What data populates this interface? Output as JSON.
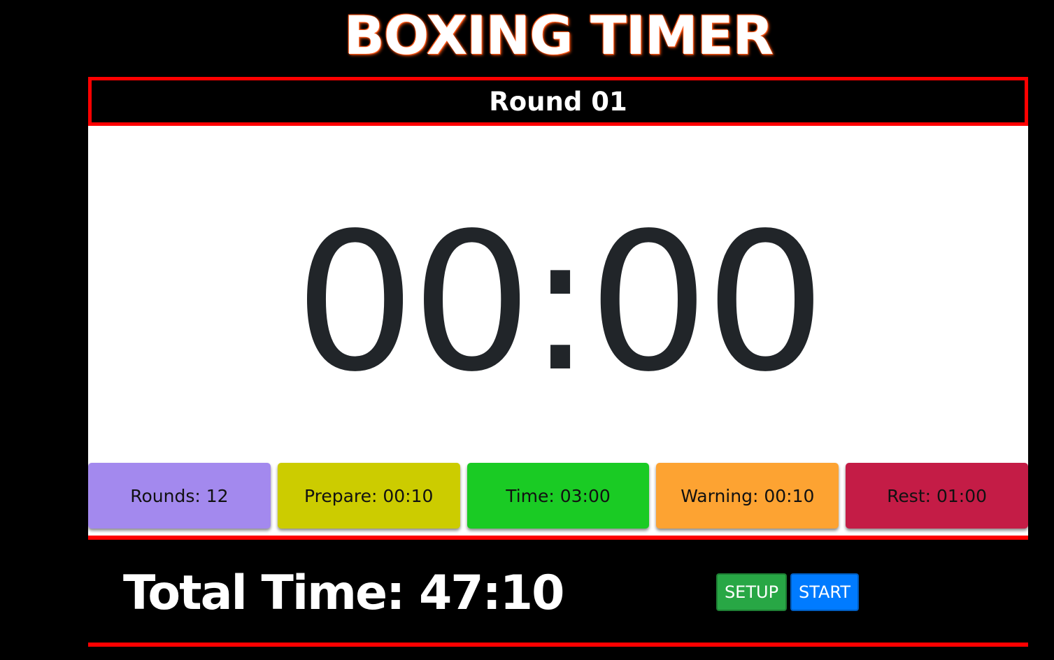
{
  "app": {
    "title": "BOXING TIMER"
  },
  "round": {
    "label": "Round 01"
  },
  "clock": {
    "display": "00:00"
  },
  "settings": [
    {
      "label": "Rounds: 12",
      "color": "#a389ee"
    },
    {
      "label": "Prepare: 00:10",
      "color": "#cccc00"
    },
    {
      "label": "Time: 03:00",
      "color": "#1acb24"
    },
    {
      "label": "Warning: 00:10",
      "color": "#fda332"
    },
    {
      "label": "Rest: 01:00",
      "color": "#c41c46"
    }
  ],
  "footer": {
    "total_time": "Total Time: 47:10",
    "setup_label": "SETUP",
    "setup_color": "#28a745",
    "start_label": "START",
    "start_color": "#007bff"
  },
  "colors": {
    "background": "#000000",
    "accent": "#ff0000",
    "title_glow": "#ff5a1a"
  }
}
